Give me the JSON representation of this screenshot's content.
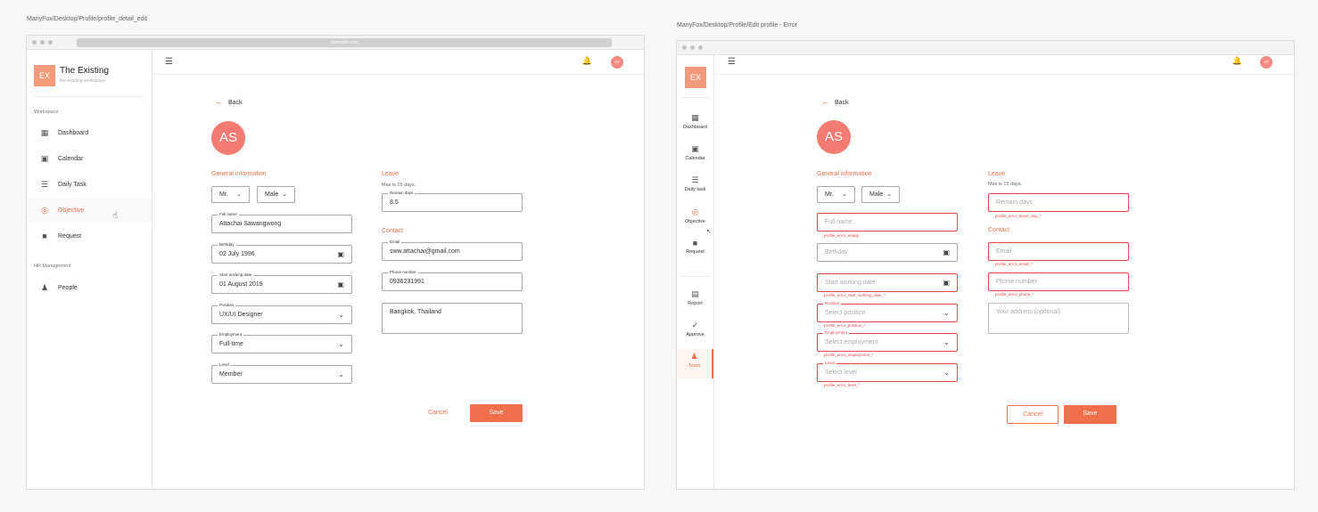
{
  "left": {
    "frame_title": "ManyFox/Desktop/Profile/profile_detail_edit",
    "url": "example.com",
    "logo": "EX",
    "workspace_name": "The Existing",
    "workspace_slug": "the-existing-workspace",
    "section_workspace": "Workspace",
    "nav": [
      "Dashboard",
      "Calendar",
      "Daily Task",
      "Objective",
      "Request"
    ],
    "section_hr": "HR Management",
    "nav_hr": [
      "People"
    ],
    "header_avatar": "AT",
    "back": "Back",
    "avatar": "AS",
    "general_title": "General information",
    "title_value": "Mr.",
    "gender_value": "Male",
    "full_name_label": "Full name",
    "full_name": "Attachai Sawangwong",
    "birthday_label": "Birthday",
    "birthday": "02 July 1996",
    "start_label": "Start working date",
    "start": "01 August 2019",
    "position_label": "Position",
    "position": "UX/UI Designer",
    "employment_label": "Employment",
    "employment": "Full-time",
    "level_label": "Level",
    "level": "Member",
    "leave_title": "Leave",
    "leave_note": "Max is 15 days.",
    "remain_label": "Remain days",
    "remain": "8.5",
    "contact_title": "Contact",
    "email_label": "Email",
    "email": "sww.attachai@gmail.com",
    "phone_label": "Phone number",
    "phone": "0936231991",
    "address": "Bangkok, Thailand",
    "cancel": "Cancel",
    "save": "Save"
  },
  "right": {
    "frame_title": "ManyFox/Desktop/Profile/Edit profile - Error",
    "logo": "EX",
    "nav": [
      "Dashboard",
      "Calendar",
      "Daily task",
      "Objective",
      "Request",
      "Report",
      "Approve",
      "Team"
    ],
    "header_avatar": "AT",
    "back": "Back",
    "avatar": "AS",
    "general_title": "General information",
    "title_value": "Mr.",
    "gender_value": "Male",
    "full_name_ph": "Full name",
    "full_name_err": "profile_error_empty",
    "birthday_ph": "Birthday",
    "start_ph": "Start working date",
    "start_err": "profile_error_start_working_date_*",
    "position_label": "Position",
    "position_ph": "Select position",
    "position_err": "profile_error_position_*",
    "employment_label": "Employment",
    "employment_ph": "Select employment",
    "employment_err": "profile_error_employment_*",
    "level_label": "Level",
    "level_ph": "Select level",
    "level_err": "profile_error_level_*",
    "leave_title": "Leave",
    "leave_note": "Max is 15 days.",
    "remain_ph": "Remain days",
    "remain_err": "profile_error_leave_day_*",
    "contact_title": "Contact",
    "email_ph": "Email",
    "email_err": "profile_error_email_*",
    "phone_ph": "Phone number",
    "phone_err": "profile_error_phone_*",
    "address_ph": "Your address (optional)",
    "cancel": "Cancel",
    "save": "Save"
  },
  "colors": {
    "accent": "#ef6f4a",
    "error": "#e8474a",
    "avatar": "#f37b71"
  }
}
